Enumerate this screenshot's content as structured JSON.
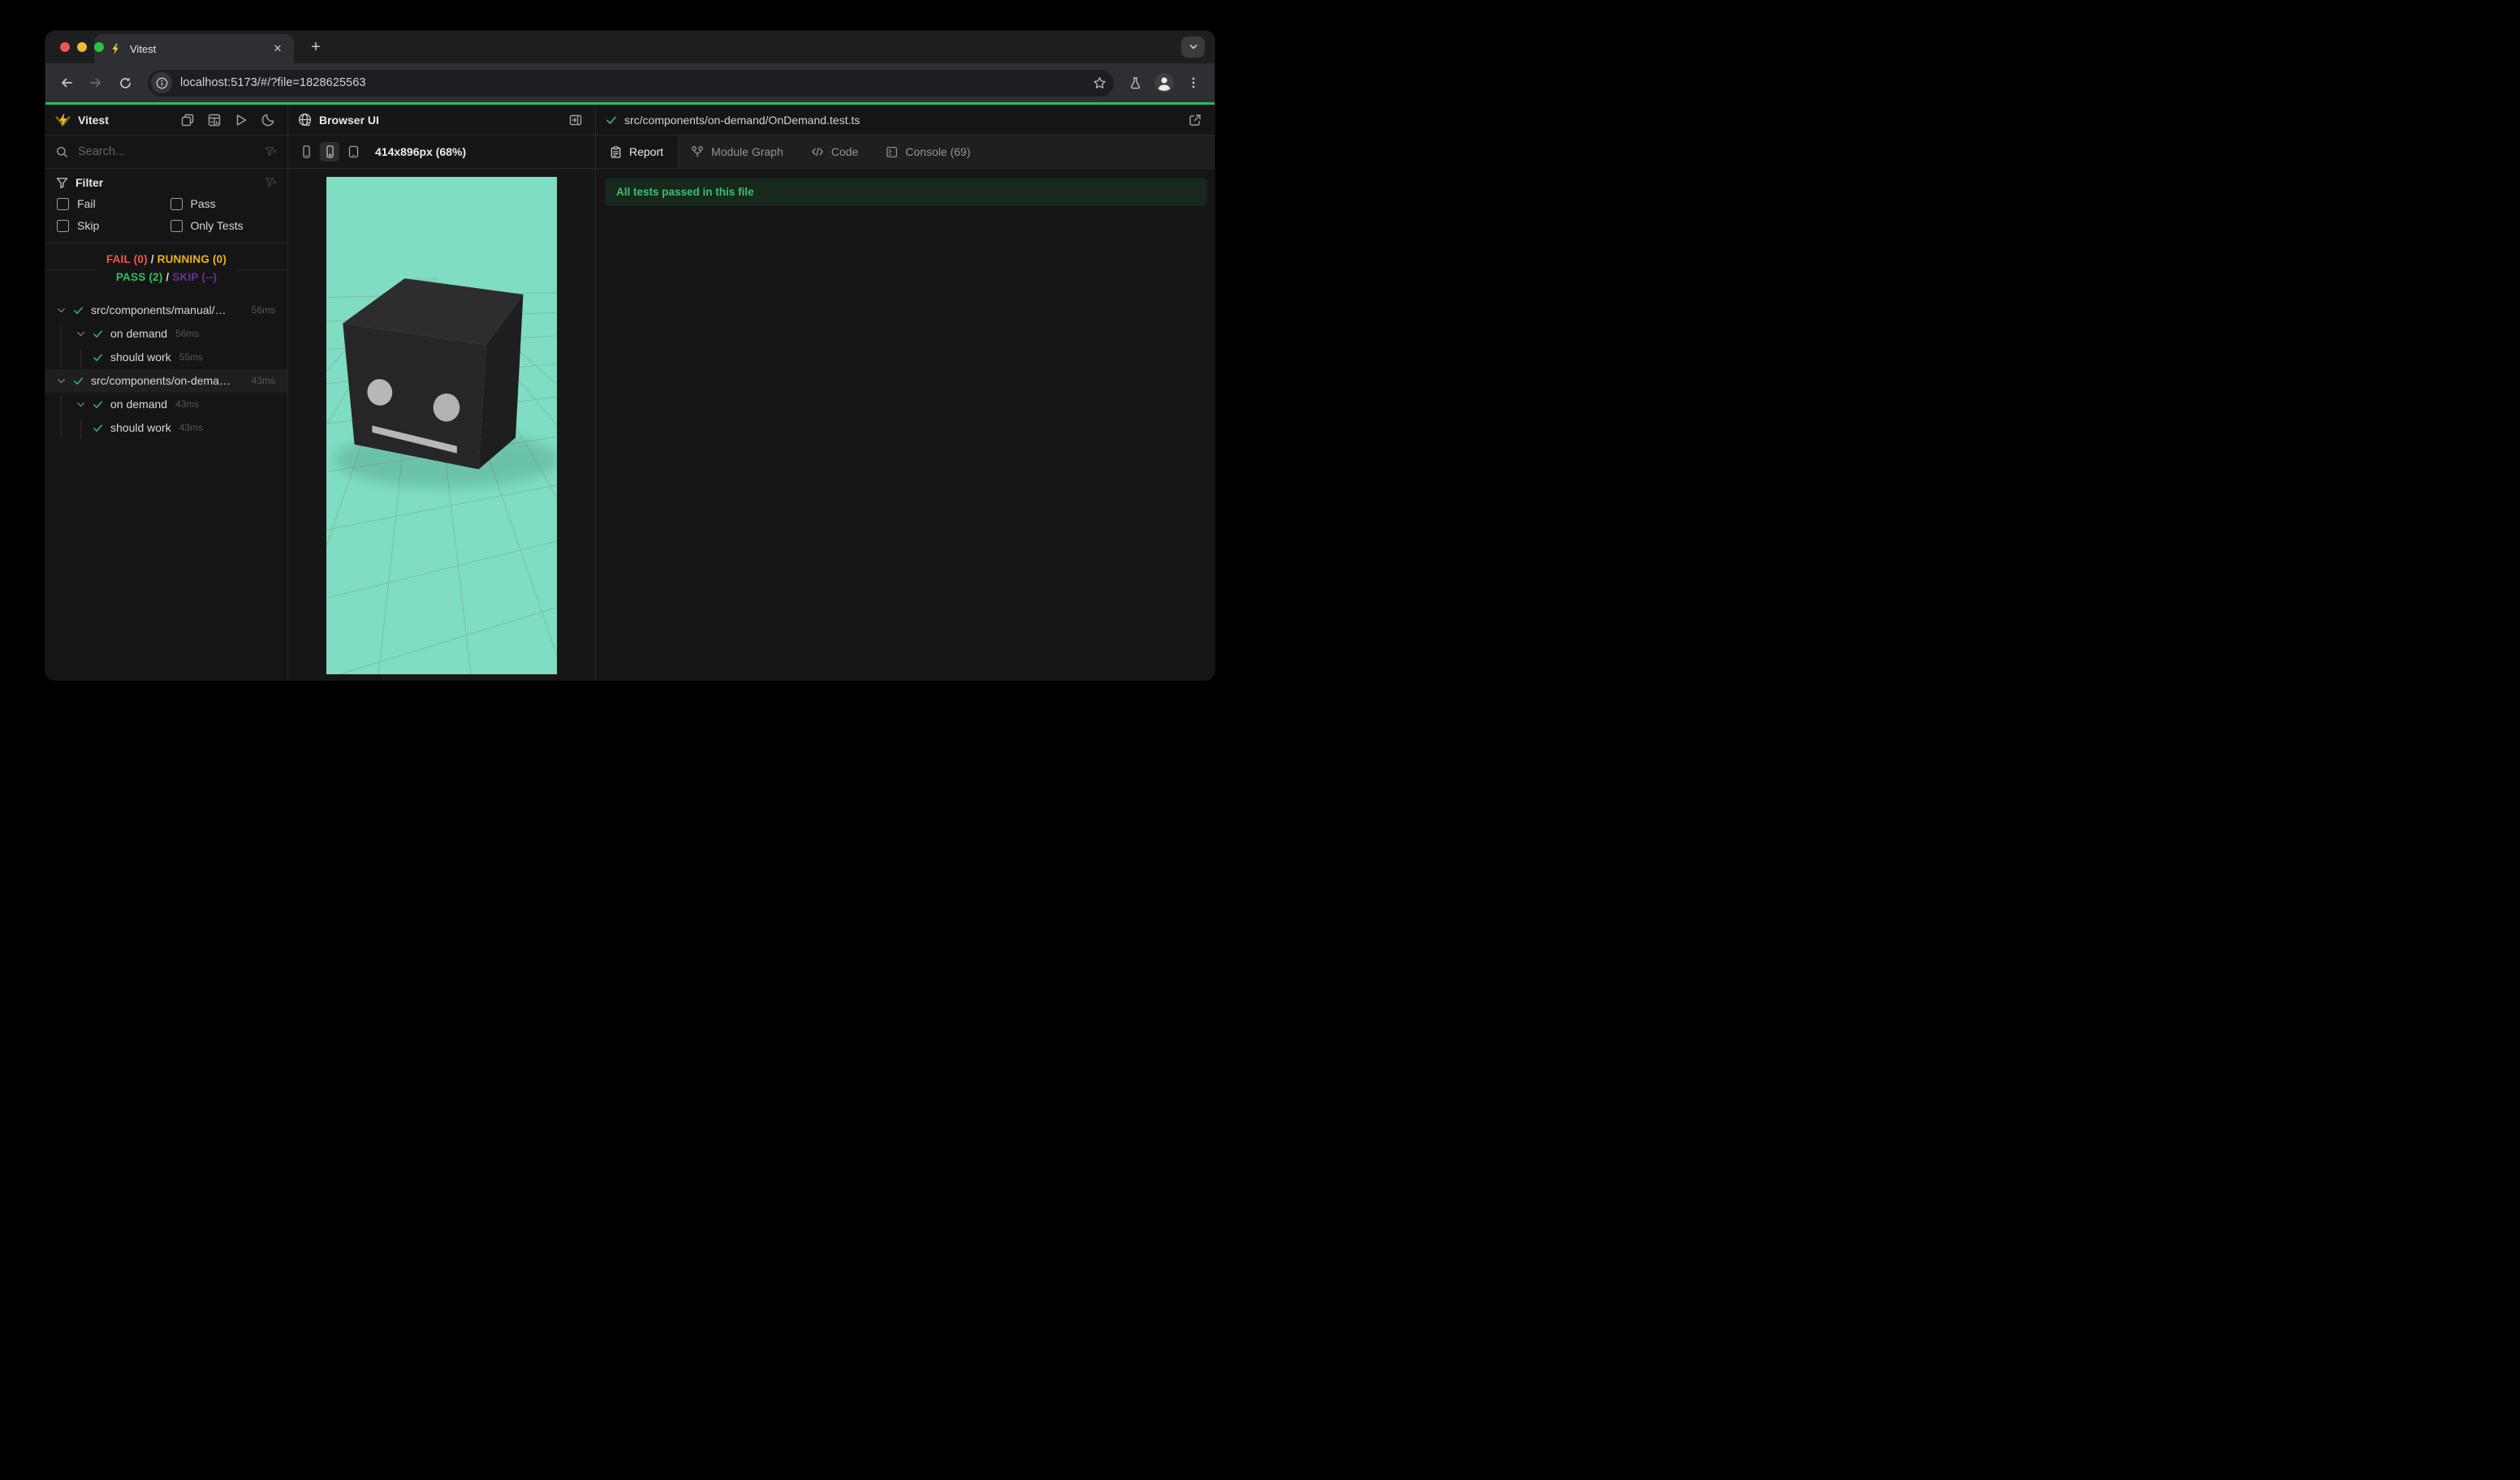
{
  "chrome": {
    "tab": {
      "title": "Vitest",
      "close_glyph": "✕"
    },
    "new_tab_glyph": "+",
    "url": "localhost:5173/#/?file=1828625563",
    "accent_line_color": "#2cbb5d"
  },
  "app": {
    "sidebar": {
      "title": "Vitest",
      "search_placeholder": "Search...",
      "filter": {
        "title": "Filter",
        "options": [
          "Fail",
          "Pass",
          "Skip",
          "Only Tests"
        ]
      },
      "summary": {
        "fail": "FAIL (0)",
        "running": "RUNNING (0)",
        "pass": "PASS (2)",
        "skip": "SKIP (--)",
        "sep": " / "
      },
      "tree": [
        {
          "name": "src/components/manual/…",
          "time": "56ms"
        },
        {
          "name": "on demand",
          "time": "56ms"
        },
        {
          "name": "should work",
          "time": "55ms"
        },
        {
          "name": "src/components/on-dema…",
          "time": "43ms"
        },
        {
          "name": "on demand",
          "time": "43ms"
        },
        {
          "name": "should work",
          "time": "43ms"
        }
      ]
    },
    "browser_panel": {
      "title": "Browser UI",
      "dimensions": "414x896px (68%)",
      "viewport_bg": "#7eddc2"
    },
    "report_panel": {
      "file_path": "src/components/on-demand/OnDemand.test.ts",
      "tabs": [
        {
          "label": "Report"
        },
        {
          "label": "Module Graph"
        },
        {
          "label": "Code"
        },
        {
          "label": "Console (69)"
        }
      ],
      "banner": "All tests passed in this file"
    },
    "colors": {
      "fail": "#f4544e",
      "running": "#ecb313",
      "pass": "#2fbe67",
      "skip": "#663399",
      "accent": "#2cbb5d",
      "banner_text": "#3cc06e",
      "scene_cube": "#262626",
      "scene_eyes": "#b7b7b7"
    }
  }
}
